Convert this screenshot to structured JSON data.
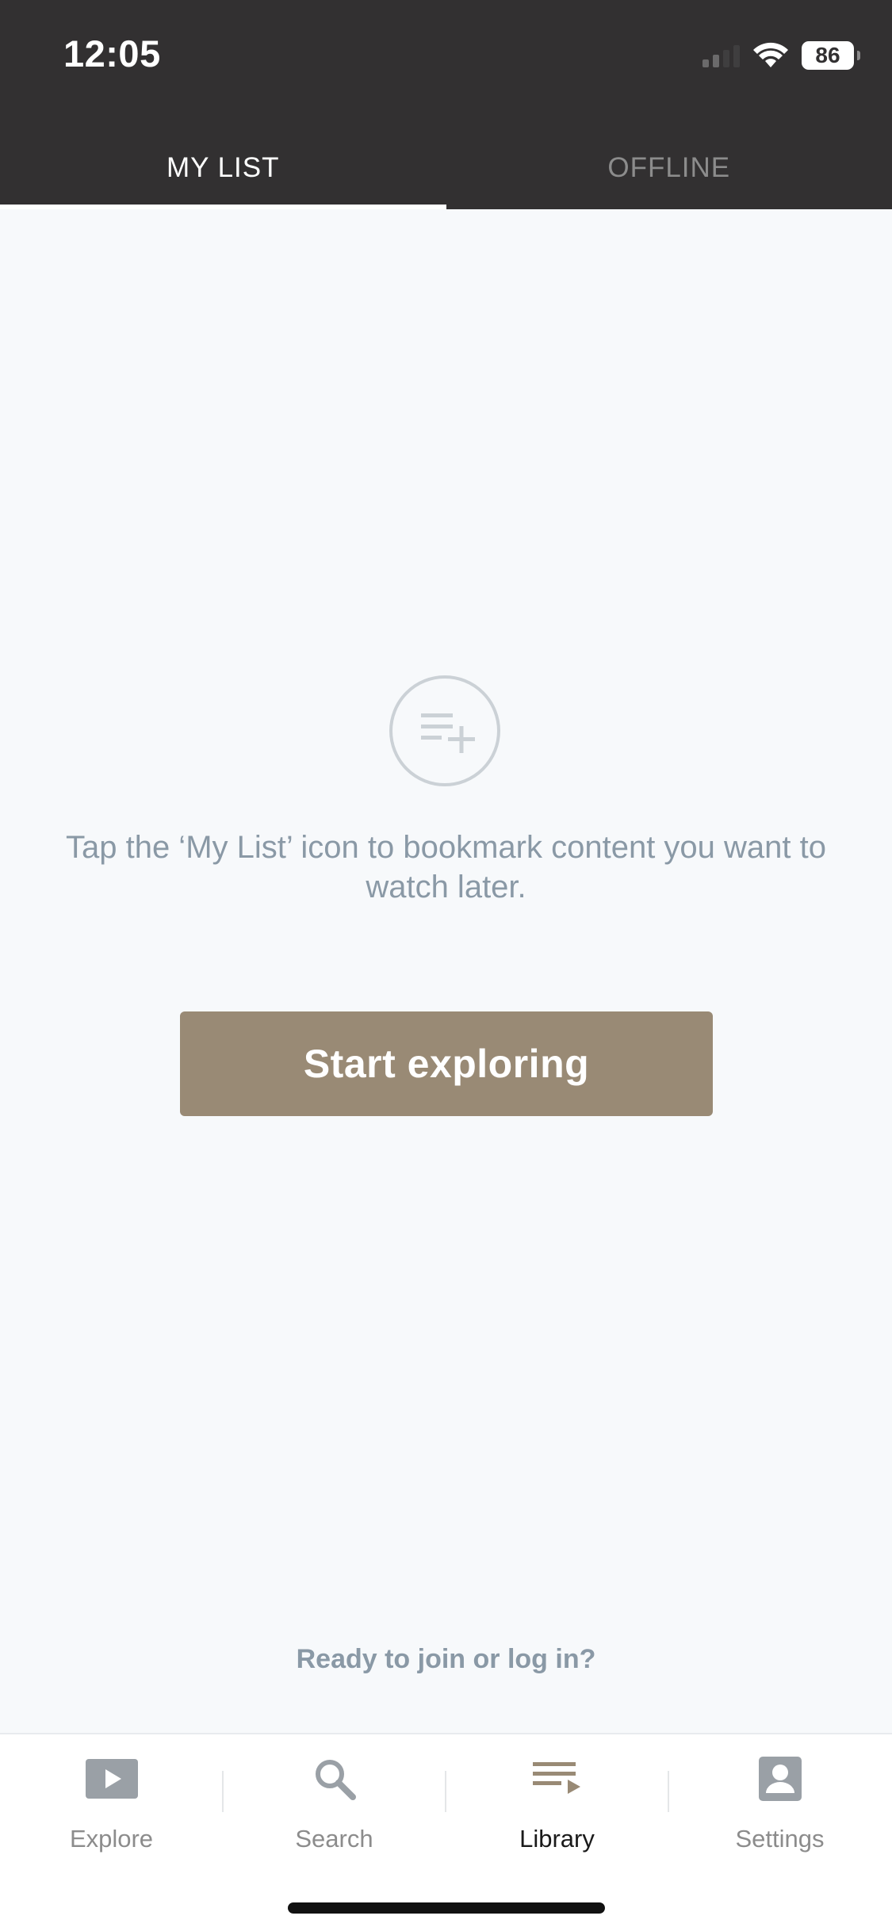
{
  "status_bar": {
    "time": "12:05",
    "battery": "86"
  },
  "tabs": [
    {
      "label": "MY LIST",
      "active": true
    },
    {
      "label": "OFFLINE",
      "active": false
    }
  ],
  "empty_state": {
    "icon": "playlist-add-icon",
    "message": "Tap the ‘My List’ icon to bookmark content you want to watch later.",
    "button_label": "Start exploring"
  },
  "join_prompt": "Ready to join or log in?",
  "bottom_nav": [
    {
      "label": "Explore",
      "icon": "play-icon",
      "active": false
    },
    {
      "label": "Search",
      "icon": "search-icon",
      "active": false
    },
    {
      "label": "Library",
      "icon": "library-icon",
      "active": true
    },
    {
      "label": "Settings",
      "icon": "account-icon",
      "active": false
    }
  ],
  "colors": {
    "header_bg": "#323031",
    "page_bg": "#f7f9fb",
    "accent": "#998a75",
    "muted_text": "#8a99a6"
  }
}
